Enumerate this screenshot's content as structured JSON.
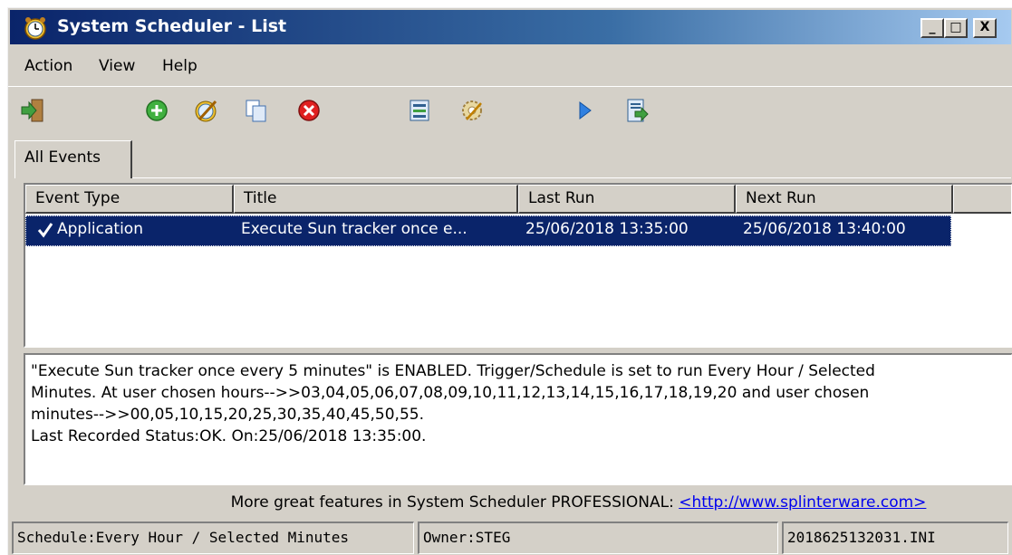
{
  "window": {
    "title": "System Scheduler - List",
    "minimize_glyph": "_",
    "maximize_glyph": "□",
    "close_glyph": "X"
  },
  "menu": [
    {
      "label": "Action"
    },
    {
      "label": "View"
    },
    {
      "label": "Help"
    }
  ],
  "toolbar": {
    "icons": [
      "exit-icon",
      "add-event-icon",
      "edit-event-icon",
      "copy-event-icon",
      "delete-event-icon",
      "properties-icon",
      "settings-icon",
      "run-icon",
      "export-icon"
    ]
  },
  "tabs": [
    {
      "label": "All Events",
      "selected": true
    }
  ],
  "list": {
    "columns": [
      "Event Type",
      "Title",
      "Last Run",
      "Next Run"
    ],
    "rows": [
      {
        "event_type": "Application",
        "title": "Execute Sun tracker once e...",
        "last_run": "25/06/2018 13:35:00",
        "next_run": "25/06/2018 13:40:00",
        "checked": true,
        "selected": true
      }
    ]
  },
  "description": {
    "lines": [
      "\"Execute Sun tracker once every 5 minutes\" is ENABLED. Trigger/Schedule is set to run Every Hour / Selected",
      "Minutes. At user chosen hours-->>03,04,05,06,07,08,09,10,11,12,13,14,15,16,17,18,19,20 and user chosen",
      "minutes-->>00,05,10,15,20,25,30,35,40,45,50,55.",
      "Last Recorded Status:OK. On:25/06/2018 13:35:00."
    ]
  },
  "promo": {
    "text": "More great features in System Scheduler PROFESSIONAL: ",
    "link": "<http://www.splinterware.com>"
  },
  "statusbar": {
    "schedule": "Schedule:Every Hour / Selected Minutes",
    "owner": "Owner:STEG",
    "file": "2018625132031.INI"
  },
  "colors": {
    "title_gradient_start": "#0a246a",
    "selection": "#0a246a",
    "window_face": "#d4d0c8",
    "link": "#0000ee"
  }
}
